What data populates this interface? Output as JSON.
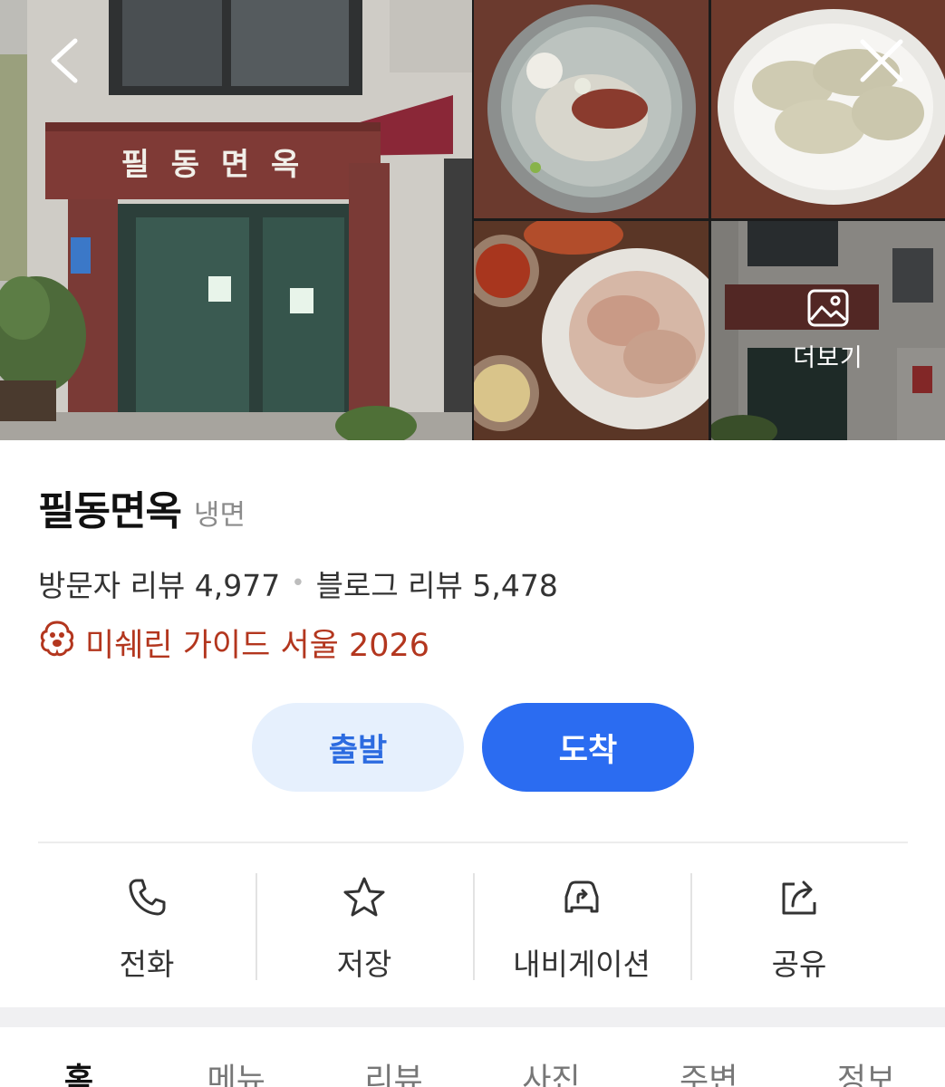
{
  "header": {
    "back_icon": "chevron-left-icon",
    "close_icon": "close-icon",
    "more_photos_label": "더보기",
    "more_photos_icon": "image-icon"
  },
  "place": {
    "name": "필동면옥",
    "category": "냉면",
    "visitor_reviews": "방문자 리뷰 4,977",
    "blog_reviews": "블로그 리뷰 5,478",
    "michelin_label": "미쉐린 가이드 서울 2026",
    "michelin_icon": "michelin-bib-icon",
    "storefront_sign": "필 동 면 옥"
  },
  "route": {
    "start_label": "출발",
    "end_label": "도착"
  },
  "actions": [
    {
      "label": "전화",
      "icon": "phone-icon"
    },
    {
      "label": "저장",
      "icon": "star-icon"
    },
    {
      "label": "내비게이션",
      "icon": "car-navigation-icon"
    },
    {
      "label": "공유",
      "icon": "share-icon"
    }
  ],
  "tabs": [
    {
      "label": "홈",
      "active": true
    },
    {
      "label": "메뉴"
    },
    {
      "label": "리뷰"
    },
    {
      "label": "사진"
    },
    {
      "label": "주변"
    },
    {
      "label": "정보"
    }
  ],
  "colors": {
    "primary": "#2b6cf1",
    "primary_soft": "#e6f0fd",
    "michelin": "#b3361e"
  }
}
